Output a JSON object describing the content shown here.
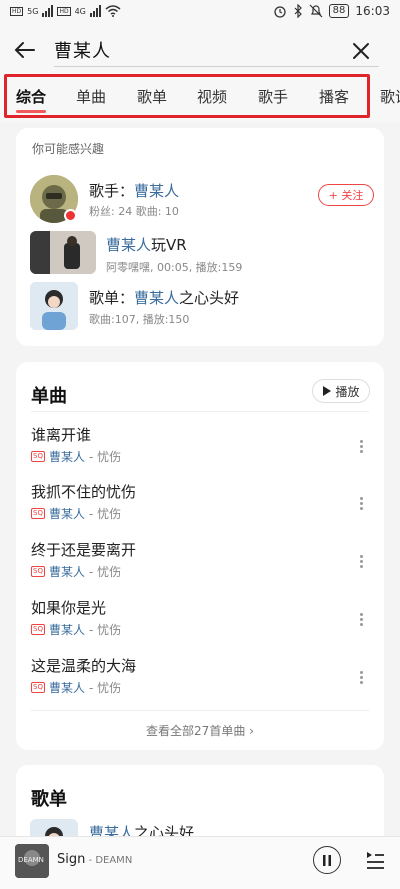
{
  "status": {
    "net1": "HD",
    "net2": "HD",
    "gen1": "5G",
    "gen2": "4G",
    "battery": "88",
    "time": "16:03"
  },
  "search": {
    "query": "曹某人"
  },
  "tabs": [
    {
      "label": "综合",
      "active": true
    },
    {
      "label": "单曲"
    },
    {
      "label": "歌单"
    },
    {
      "label": "视频"
    },
    {
      "label": "歌手"
    },
    {
      "label": "播客"
    },
    {
      "label": "歌词"
    }
  ],
  "interest": {
    "title": "你可能感兴趣",
    "artist": {
      "prefix": "歌手：",
      "name": "曹某人",
      "stats": "粉丝: 24  歌曲: 10",
      "follow_label": "+ 关注"
    },
    "video": {
      "title_hl": "曹某人",
      "title_rest": "玩VR",
      "meta": "阿零嘿嘿, 00:05, 播放:159"
    },
    "playlist": {
      "prefix": "歌单：",
      "title_hl": "曹某人",
      "title_rest": "之心头好",
      "meta": "歌曲:107, 播放:150"
    }
  },
  "singles": {
    "title": "单曲",
    "play_label": "播放",
    "songs": [
      {
        "name": "谁离开谁",
        "tag": "SQ",
        "artist": "曹某人",
        "album": " - 忧伤"
      },
      {
        "name": "我抓不住的忧伤",
        "tag": "SQ",
        "artist": "曹某人",
        "album": " - 忧伤"
      },
      {
        "name": "终于还是要离开",
        "tag": "SQ",
        "artist": "曹某人",
        "album": " - 忧伤"
      },
      {
        "name": "如果你是光",
        "tag": "SQ",
        "artist": "曹某人",
        "album": " - 忧伤"
      },
      {
        "name": "这是温柔的大海",
        "tag": "SQ",
        "artist": "曹某人",
        "album": " - 忧伤"
      }
    ],
    "view_all": "查看全部27首单曲 ›"
  },
  "playlists": {
    "title": "歌单",
    "first_hl": "曹某人",
    "first_rest": "之心头好"
  },
  "player": {
    "song": "Sign",
    "artist": " - DEAMN",
    "cover_text": "DEAMN"
  }
}
